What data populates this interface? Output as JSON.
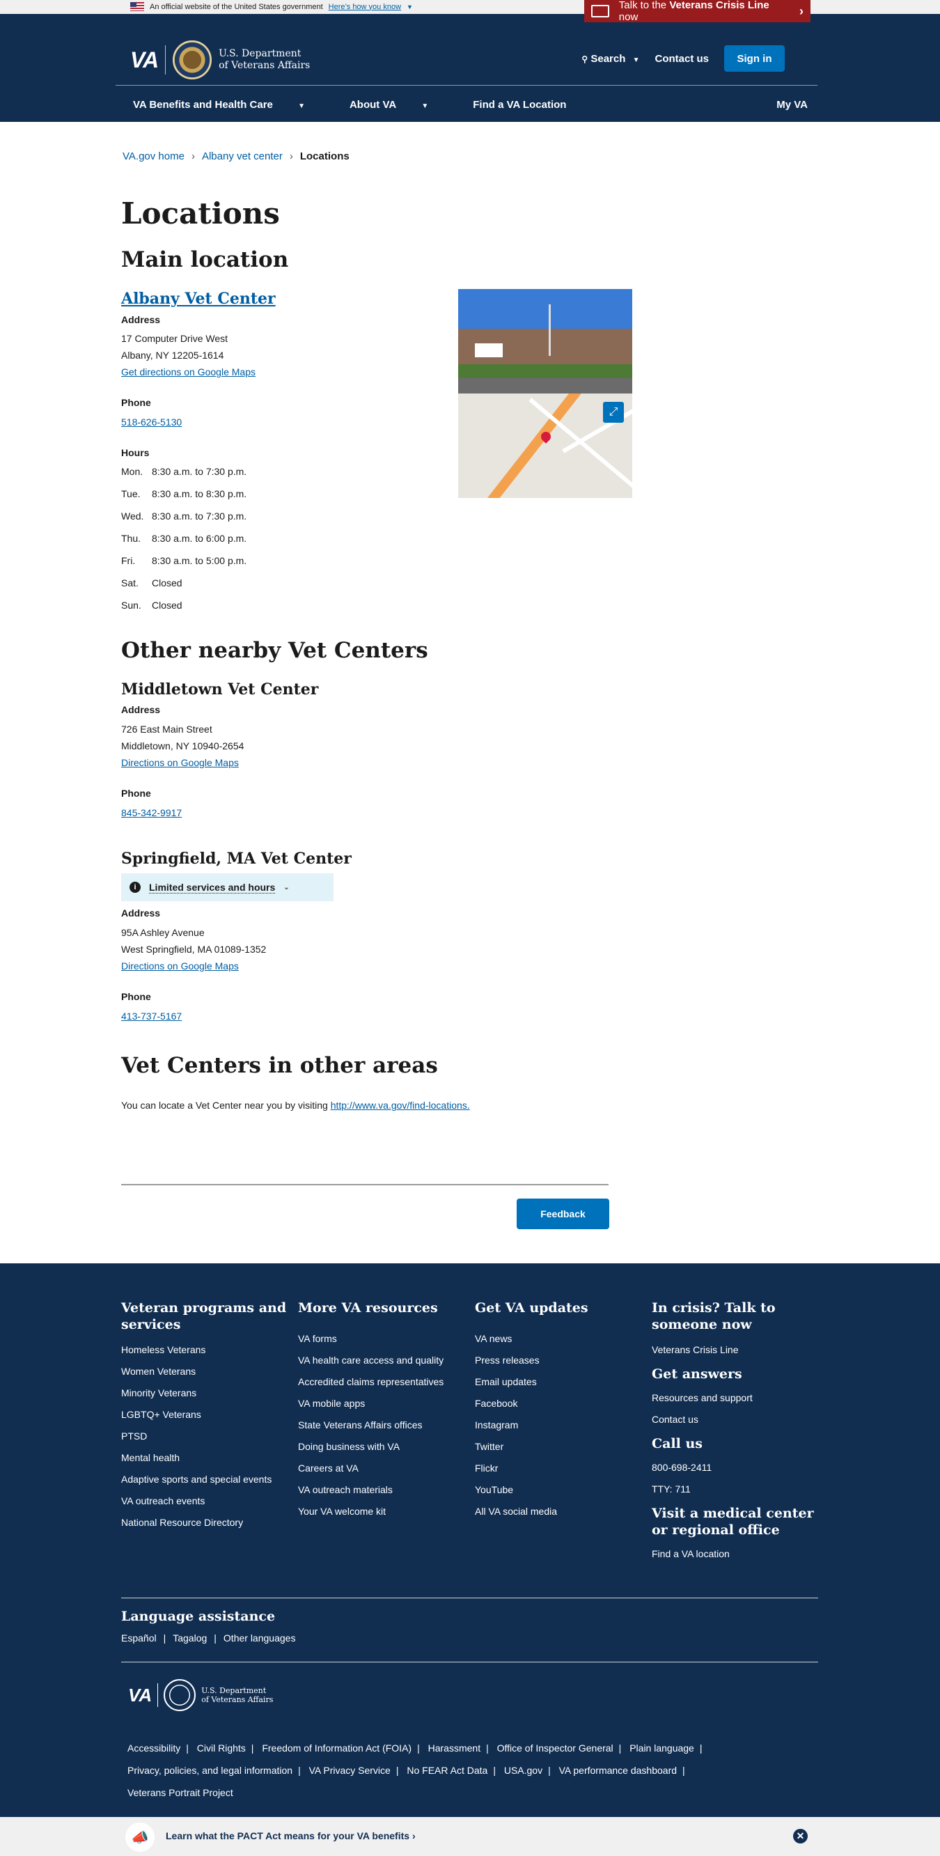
{
  "banner": {
    "official_text": "An official website of the United States government",
    "how_link": "Here’s how you know"
  },
  "crisis": {
    "pre": "Talk to the",
    "bold": "Veterans Crisis Line",
    "post": "now"
  },
  "header": {
    "logo_text": "VA",
    "dept_line1": "U.S. Department",
    "dept_line2": "of Veterans Affairs",
    "search_label": "Search",
    "contact_label": "Contact us",
    "signin_label": "Sign in",
    "nav": [
      "VA Benefits and Health Care",
      "About VA",
      "Find a VA Location"
    ],
    "myva_label": "My VA"
  },
  "breadcrumb": [
    "VA.gov home",
    "Albany vet center",
    "Locations"
  ],
  "page_title": "Locations",
  "main_location": {
    "heading": "Main location",
    "name": "Albany Vet Center",
    "address_label": "Address",
    "address_line1": "17 Computer Drive West",
    "address_line2": "Albany, NY 12205-1614",
    "directions_link": "Get directions on Google Maps",
    "phone_label": "Phone",
    "phone": "518-626-5130",
    "hours_label": "Hours",
    "hours": [
      {
        "day": "Mon.",
        "time": "8:30 a.m. to 7:30 p.m."
      },
      {
        "day": "Tue.",
        "time": "8:30 a.m. to 8:30 p.m."
      },
      {
        "day": "Wed.",
        "time": "8:30 a.m. to 7:30 p.m."
      },
      {
        "day": "Thu.",
        "time": "8:30 a.m. to 6:00 p.m."
      },
      {
        "day": "Fri.",
        "time": "8:30 a.m. to 5:00 p.m."
      },
      {
        "day": "Sat.",
        "time": "Closed"
      },
      {
        "day": "Sun.",
        "time": "Closed"
      }
    ]
  },
  "nearby": {
    "heading": "Other nearby Vet Centers",
    "centers": [
      {
        "name": "Middletown Vet Center",
        "address_label": "Address",
        "address_line1": "726 East Main Street",
        "address_line2": "Middletown, NY 10940-2654",
        "directions_link": "Directions on Google Maps",
        "phone_label": "Phone",
        "phone": "845-342-9917"
      },
      {
        "name": "Springfield, MA Vet Center",
        "alert": "Limited services and hours",
        "address_label": "Address",
        "address_line1": "95A Ashley Avenue",
        "address_line2": "West Springfield, MA 01089-1352",
        "directions_link": "Directions on Google Maps",
        "phone_label": "Phone",
        "phone": "413-737-5167"
      }
    ]
  },
  "other_areas": {
    "heading": "Vet Centers in other areas",
    "text": "You can locate a Vet Center near you by visiting",
    "link": "http://www.va.gov/find-locations."
  },
  "feedback_label": "Feedback",
  "footer": {
    "col1": {
      "heading": "Veteran programs and services",
      "links": [
        "Homeless Veterans",
        "Women Veterans",
        "Minority Veterans",
        "LGBTQ+ Veterans",
        "PTSD",
        "Mental health",
        "Adaptive sports and special events",
        "VA outreach events",
        "National Resource Directory"
      ]
    },
    "col2": {
      "heading": "More VA resources",
      "links": [
        "VA forms",
        "VA health care access and quality",
        "Accredited claims representatives",
        "VA mobile apps",
        "State Veterans Affairs offices",
        "Doing business with VA",
        "Careers at VA",
        "VA outreach materials",
        "Your VA welcome kit"
      ]
    },
    "col3": {
      "heading": "Get VA updates",
      "links": [
        "VA news",
        "Press releases",
        "Email updates",
        "Facebook",
        "Instagram",
        "Twitter",
        "Flickr",
        "YouTube",
        "All VA social media"
      ]
    },
    "col4": {
      "crisis_heading": "In crisis? Talk to someone now",
      "crisis_link": "Veterans Crisis Line",
      "answers_heading": "Get answers",
      "answers_links": [
        "Resources and support",
        "Contact us"
      ],
      "call_heading": "Call us",
      "call_links": [
        "800-698-2411",
        "TTY: 711"
      ],
      "visit_heading": "Visit a medical center or regional office",
      "visit_link": "Find a VA location"
    },
    "language_heading": "Language assistance",
    "languages": [
      "Español",
      "Tagalog",
      "Other languages"
    ],
    "logo_text": "VA",
    "dept_line1": "U.S. Department",
    "dept_line2": "of Veterans Affairs",
    "legal_links": [
      "Accessibility",
      "Civil Rights",
      "Freedom of Information Act (FOIA)",
      "Harassment",
      "Office of Inspector General",
      "Plain language",
      "Privacy, policies, and legal information",
      "VA Privacy Service",
      "No FEAR Act Data",
      "USA.gov",
      "VA performance dashboard",
      "Veterans Portrait Project"
    ]
  },
  "pact": {
    "text": "Learn what the PACT Act means for your VA benefits"
  },
  "colors": {
    "navy": "#112e51",
    "link": "#005ea2",
    "button": "#0071bb",
    "crisis": "#981b1e"
  }
}
